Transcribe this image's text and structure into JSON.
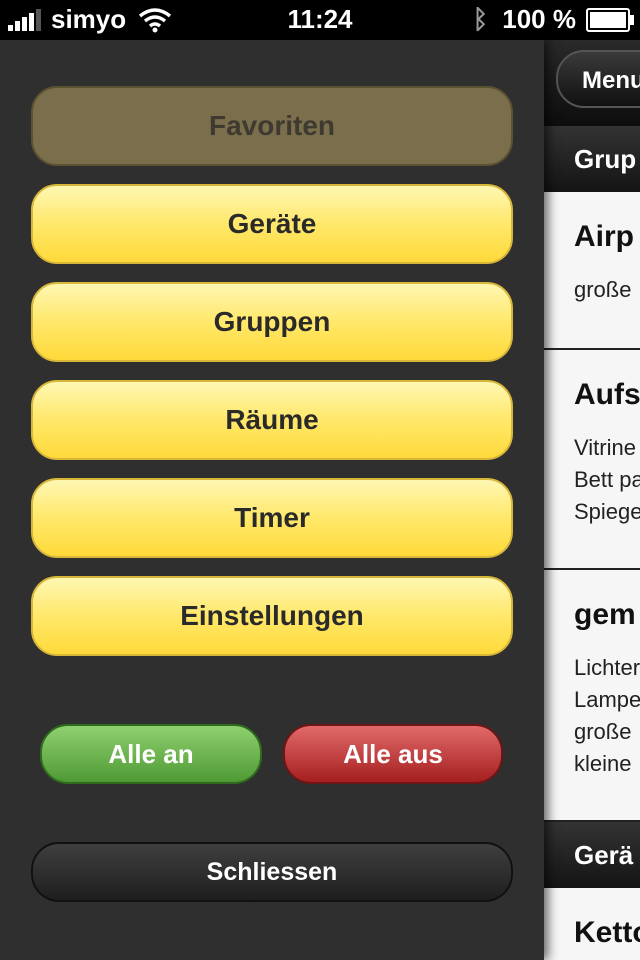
{
  "status": {
    "carrier": "simyo",
    "time": "11:24",
    "battery": "100 %",
    "battery_level": 1.0,
    "icons": [
      "signal-icon",
      "wifi-icon",
      "bluetooth-icon",
      "battery-icon"
    ]
  },
  "menu": {
    "favorites": "Favoriten",
    "items": [
      "Geräte",
      "Gruppen",
      "Räume",
      "Timer",
      "Einstellungen"
    ],
    "all_on": "Alle an",
    "all_off": "Alle aus",
    "close": "Schliessen"
  },
  "behind": {
    "menu_button": "Menu",
    "section1": "Grup",
    "items": [
      {
        "title": "Airp",
        "lines": [
          "große"
        ]
      },
      {
        "title": "Aufs",
        "lines": [
          "Vitrine",
          "Bett pa",
          "Spiege"
        ]
      },
      {
        "title": "gem",
        "lines": [
          "Lichter",
          "Lampe",
          "große",
          "kleine"
        ]
      }
    ],
    "section2": "Gerä",
    "item_last": "Ketto"
  },
  "colors": {
    "yellow_button": "#ffe86a",
    "favorites_button": "#7a6e4c",
    "green_button": "#4f9a34",
    "red_button": "#a51f1f",
    "menu_background": "#2f2f2f"
  }
}
